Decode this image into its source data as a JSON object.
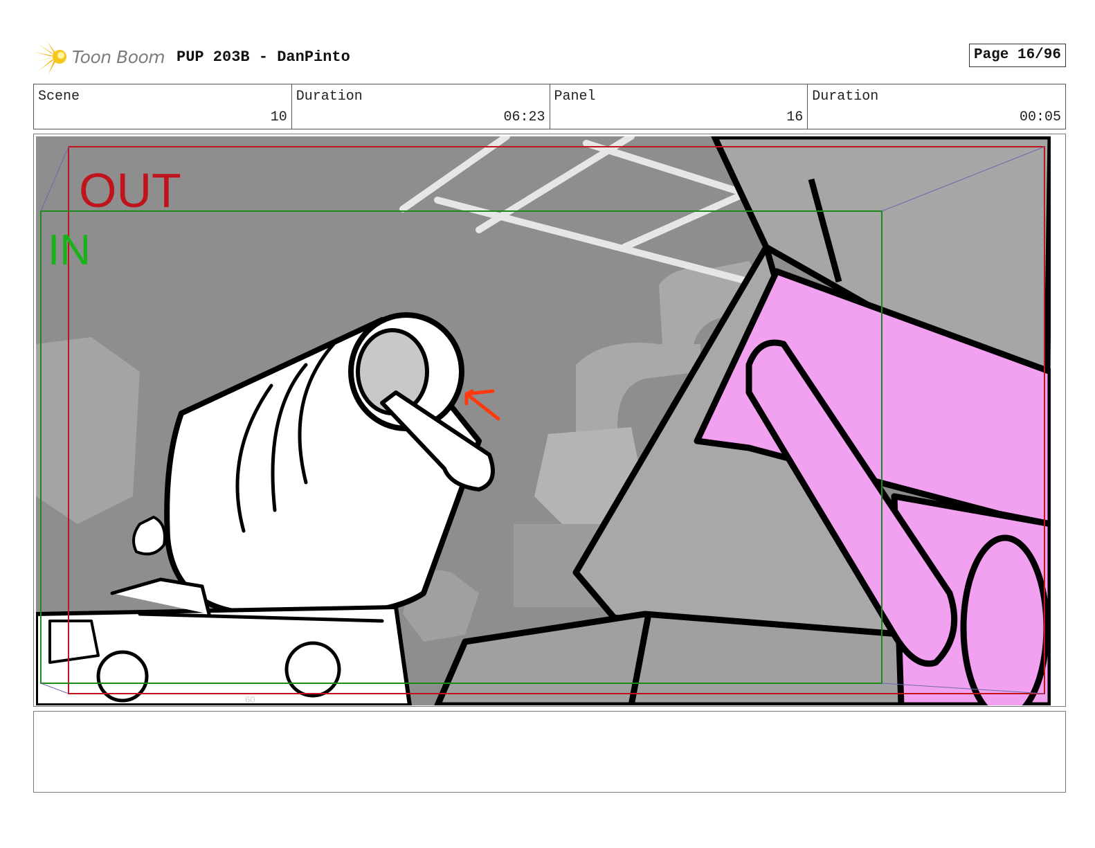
{
  "header": {
    "logo_text": "Toon Boom",
    "title": "PUP 203B - DanPinto",
    "page": "Page 16/96"
  },
  "info": {
    "scene_label": "Scene",
    "scene_value": "10",
    "scene_duration_label": "Duration",
    "scene_duration_value": "06:23",
    "panel_label": "Panel",
    "panel_value": "16",
    "panel_duration_label": "Duration",
    "panel_duration_value": "00:05"
  },
  "panel": {
    "out_label": "OUT",
    "in_label": "IN",
    "frame_number": "60",
    "colors": {
      "out_frame": "#c0141c",
      "in_frame": "#1a8a1a",
      "in_text": "#1ab21a",
      "pink": "#f2a0f0",
      "arrow": "#ff3a10",
      "background": "#8e8e8e"
    }
  },
  "notes": {
    "text": ""
  }
}
